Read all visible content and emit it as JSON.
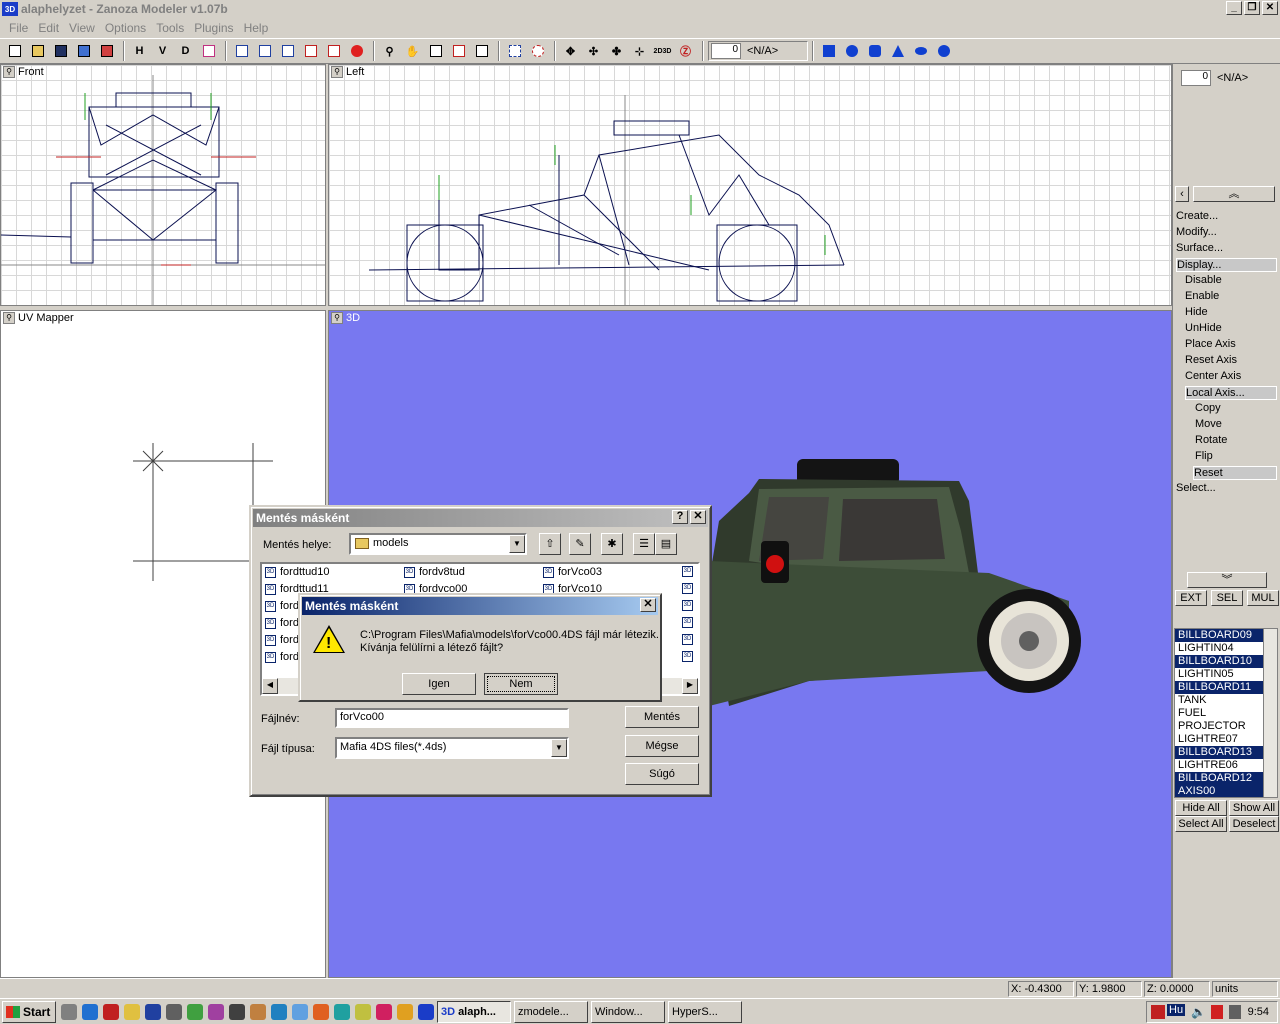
{
  "window": {
    "title": "alaphelyzet - Zanoza Modeler v1.07b",
    "app_icon": "3D"
  },
  "menu": [
    "File",
    "Edit",
    "View",
    "Options",
    "Tools",
    "Plugins",
    "Help"
  ],
  "toolbar": {
    "letters": [
      "H",
      "V",
      "D"
    ],
    "na_value": "0",
    "na_label": "<N/A>"
  },
  "viewports": {
    "front": "Front",
    "left": "Left",
    "uv": "UV Mapper",
    "three_d": "3D"
  },
  "right_panel": {
    "na_value": "0",
    "na_label": "<N/A>",
    "menu": [
      {
        "label": "Create..."
      },
      {
        "label": "Modify..."
      },
      {
        "label": "Surface..."
      },
      {
        "label": "Display..."
      },
      {
        "label": "Disable"
      },
      {
        "label": "Enable"
      },
      {
        "label": "Hide"
      },
      {
        "label": "UnHide"
      },
      {
        "label": "Place Axis"
      },
      {
        "label": "Reset Axis"
      },
      {
        "label": "Center Axis"
      },
      {
        "label": "Local Axis..."
      },
      {
        "label": "Copy"
      },
      {
        "label": "Move"
      },
      {
        "label": "Rotate"
      },
      {
        "label": "Flip"
      },
      {
        "label": "Reset"
      },
      {
        "label": "Select..."
      }
    ],
    "modes": [
      "EXT",
      "SEL",
      "MUL"
    ],
    "objects": [
      {
        "name": "BILLBOARD09",
        "selected": true
      },
      {
        "name": "LIGHTIN04",
        "selected": false
      },
      {
        "name": "BILLBOARD10",
        "selected": true
      },
      {
        "name": "LIGHTIN05",
        "selected": false
      },
      {
        "name": "BILLBOARD11",
        "selected": true
      },
      {
        "name": "TANK",
        "selected": false
      },
      {
        "name": "FUEL",
        "selected": false
      },
      {
        "name": "PROJECTOR",
        "selected": false
      },
      {
        "name": "LIGHTRE07",
        "selected": false
      },
      {
        "name": "BILLBOARD13",
        "selected": true
      },
      {
        "name": "LIGHTRE06",
        "selected": false
      },
      {
        "name": "BILLBOARD12",
        "selected": true
      },
      {
        "name": "AXIS00",
        "selected": true
      }
    ],
    "hide_all": "Hide All",
    "show_all": "Show All",
    "select_all": "Select All",
    "deselect": "Deselect"
  },
  "status": {
    "x": "X: -0.4300",
    "y": "Y: 1.9800",
    "z": "Z: 0.0000",
    "units": "units"
  },
  "save_dialog": {
    "title": "Mentés másként",
    "location_label": "Mentés helye:",
    "location_value": "models",
    "files": [
      "fordttud10",
      "fordttud11",
      "ford",
      "ford",
      "ford",
      "ford",
      "fordv8tud",
      "fordvco00",
      "forVco03",
      "forVco10"
    ],
    "filename_label": "Fájlnév:",
    "filename_value": "forVco00",
    "filetype_label": "Fájl típusa:",
    "filetype_value": "Mafia 4DS files(*.4ds)",
    "save_btn": "Mentés",
    "cancel_btn": "Mégse",
    "help_btn": "Súgó"
  },
  "confirm_dialog": {
    "title": "Mentés másként",
    "message1": "C:\\Program Files\\Mafia\\models\\forVco00.4DS fájl már létezik.",
    "message2": "Kívánja felülírni a létező fájlt?",
    "yes": "Igen",
    "no": "Nem"
  },
  "taskbar": {
    "start": "Start",
    "tasks": [
      "alaph...",
      "zmodele...",
      "Window...",
      "HyperS..."
    ],
    "clock": "9:54",
    "lang": "Hu"
  }
}
